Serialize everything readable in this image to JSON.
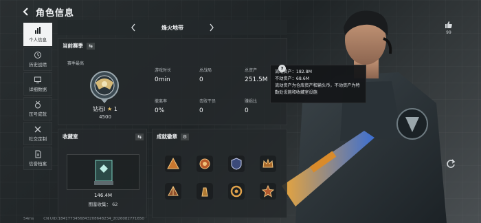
{
  "header": {
    "title": "角色信息"
  },
  "nav": {
    "items": [
      {
        "label": "个人信息",
        "icon": "bar-chart-icon",
        "active": true
      },
      {
        "label": "历史战绩",
        "icon": "history-icon",
        "active": false
      },
      {
        "label": "详细数据",
        "icon": "monitor-icon",
        "active": false
      },
      {
        "label": "压号成就",
        "icon": "medal-icon",
        "active": false
      },
      {
        "label": "社交定制",
        "icon": "tools-icon",
        "active": false
      },
      {
        "label": "信誉档案",
        "icon": "file-icon",
        "active": false
      }
    ]
  },
  "map": {
    "name": "烽火地带"
  },
  "season": {
    "heading": "当前赛季",
    "best_label": "赛季最高",
    "rank_name": "钻石I",
    "rank_star": "★",
    "rank_stars": "1",
    "rank_score": "4500",
    "stats": [
      {
        "label": "游戏时长",
        "value": "0min"
      },
      {
        "label": "总战局",
        "value": "0"
      },
      {
        "label": "总资产",
        "value": "251.5M"
      },
      {
        "label": "撤离率",
        "value": "0%"
      },
      {
        "label": "击败干员",
        "value": "0"
      },
      {
        "label": "赚损比",
        "value": "0"
      }
    ]
  },
  "tooltip": {
    "line1": "流动资产：182.8M",
    "line2": "不动资产：68.6M",
    "line3": "流动资产为仓库资产和输头币，不动资产为特勤处设施和收藏室设施"
  },
  "collection": {
    "heading": "收藏室",
    "value": "146.4M",
    "count_label": "图鉴收集：",
    "count": "62"
  },
  "achievements": {
    "heading": "成就徽章"
  },
  "like": {
    "count": "99"
  },
  "footer": {
    "ping": "54ms",
    "uid": "CN UID:1841773456843208648234_2026082771650"
  },
  "colors": {
    "accent": "#f2f3f4",
    "panel": "#24292b",
    "gold": "#e9c46a"
  }
}
